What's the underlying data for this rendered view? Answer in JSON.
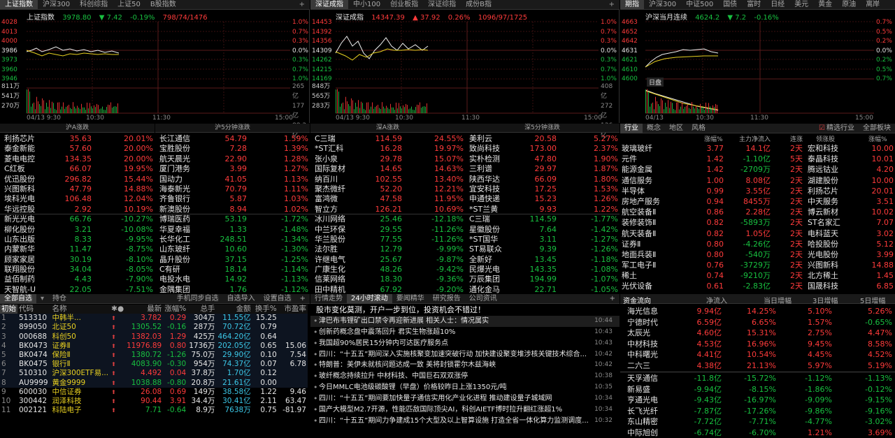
{
  "p1": {
    "tabs": [
      "上证指数",
      "沪深300",
      "科创综指",
      "上证50",
      "B股指数"
    ],
    "name": "上证指数",
    "price": "3978.80",
    "chg": "▼ 7.42",
    "pct": "-0.19%",
    "stat": "798/74/1476",
    "yl": [
      "4028",
      "4013",
      "4000",
      "3986",
      "3973",
      "3960",
      "3946"
    ],
    "yr": [
      "1.0%",
      "0.7%",
      "0.3%",
      "0.0%",
      "0.3%",
      "0.7%",
      "1.0%"
    ],
    "vl": [
      "811万",
      "541万",
      "270万"
    ],
    "vr": [
      "265亿",
      "177亿",
      "88.3亿"
    ],
    "t": [
      "04/13 9:30",
      "10:30",
      "11:30",
      "15:00"
    ]
  },
  "p2": {
    "tabs": [
      "深证成指",
      "中小100",
      "创业板指",
      "深证综指",
      "成份B指"
    ],
    "name": "深证成指",
    "price": "14347.39",
    "chg": "▲ 37.92",
    "pct": "0.26%",
    "stat": "1096/97/1725",
    "yl": [
      "14453",
      "14392",
      "14356",
      "14309",
      "14262",
      "14215",
      "14169"
    ],
    "yr": [
      "1.0%",
      "0.7%",
      "0.3%",
      "0.0%",
      "0.3%",
      "0.7%",
      "1.0%"
    ],
    "vl": [
      "848万",
      "565万",
      "283万"
    ],
    "vr": [
      "408亿",
      "272亿",
      "136亿"
    ],
    "t": [
      "04/13 9:30",
      "10:30",
      "11:30",
      "15:00"
    ]
  },
  "p3": {
    "tabs": [
      "期指",
      "沪深300",
      "中证500",
      "国债",
      "富时",
      "日经",
      "美元",
      "黄金",
      "原油",
      "离岸"
    ],
    "name": "沪深当月连续",
    "price": "4624.2",
    "chg": "▼ 7.2",
    "pct": "-0.16%",
    "yl": [
      "4663",
      "4652",
      "4642",
      "4631",
      "4621",
      "4610",
      "4600"
    ],
    "yr": [
      "0.7%",
      "0.5%",
      "0.2%",
      "0.0%",
      "0.2%",
      "0.5%",
      "0.7%"
    ],
    "t": [
      "04/13",
      "10:30",
      "11:30",
      "15:00"
    ],
    "daily": "日盘"
  },
  "ranks": {
    "h1": "沪A涨跌",
    "h2": "沪5分钟涨跌",
    "h3": "深A涨跌",
    "h4": "深5分钟涨跌",
    "c1": [
      [
        "利扬芯片",
        "35.63",
        "20.01%",
        "r"
      ],
      [
        "泰金新能",
        "57.60",
        "20.00%",
        "r"
      ],
      [
        "菱电电控",
        "134.35",
        "20.00%",
        "r"
      ],
      [
        "C红板",
        "66.07",
        "19.95%",
        "r"
      ],
      [
        "优迅股份",
        "296.82",
        "15.44%",
        "r"
      ],
      [
        "兴图新科",
        "47.79",
        "14.88%",
        "r"
      ],
      [
        "埃科光电",
        "106.48",
        "12.04%",
        "r"
      ],
      [
        "华远控股",
        "2.92",
        "10.19%",
        "r"
      ],
      [
        "新光光电",
        "66.76",
        "-10.27%",
        "g"
      ],
      [
        "柳化股份",
        "3.21",
        "-10.08%",
        "g"
      ],
      [
        "山东出版",
        "8.33",
        "-9.95%",
        "g"
      ],
      [
        "内蒙新华",
        "11.47",
        "-8.75%",
        "g"
      ],
      [
        "顾家家居",
        "30.19",
        "-8.10%",
        "g"
      ],
      [
        "联翔股份",
        "34.04",
        "-8.05%",
        "g"
      ],
      [
        "益佰制药",
        "4.43",
        "-7.90%",
        "g"
      ],
      [
        "天智航-U",
        "22.05",
        "-7.51%",
        "g"
      ]
    ],
    "c2": [
      [
        "长江通信",
        "54.79",
        "1.59%",
        "r"
      ],
      [
        "宝胜股份",
        "7.28",
        "1.39%",
        "r"
      ],
      [
        "航天晨光",
        "22.90",
        "1.28%",
        "r"
      ],
      [
        "厦门港务",
        "3.99",
        "1.27%",
        "r"
      ],
      [
        "国动力",
        "41.05",
        "1.13%",
        "r"
      ],
      [
        "海泰新光",
        "70.79",
        "1.11%",
        "r"
      ],
      [
        "齐鲁银行",
        "5.87",
        "1.03%",
        "r"
      ],
      [
        "新澳股份",
        "8.94",
        "1.02%",
        "r"
      ],
      [
        "博瑞医药",
        "53.19",
        "-1.72%",
        "g"
      ],
      [
        "华夏幸福",
        "1.33",
        "-1.48%",
        "g"
      ],
      [
        "长华化工",
        "248.51",
        "-1.34%",
        "g"
      ],
      [
        "山东玻纤",
        "10.60",
        "-1.30%",
        "g"
      ],
      [
        "晶升股份",
        "37.15",
        "-1.25%",
        "g"
      ],
      [
        "C有研",
        "18.14",
        "-1.14%",
        "g"
      ],
      [
        "电投水电",
        "14.92",
        "-1.13%",
        "g"
      ],
      [
        "金隅集团",
        "1.76",
        "-1.12%",
        "g"
      ]
    ],
    "c3": [
      [
        "C三瑞",
        "114.59",
        "24.55%",
        "r"
      ],
      [
        "*ST汇科",
        "16.28",
        "19.97%",
        "r"
      ],
      [
        "张小泉",
        "29.78",
        "15.07%",
        "r"
      ],
      [
        "国际复材",
        "14.65",
        "14.63%",
        "r"
      ],
      [
        "纳百川",
        "102.55",
        "13.40%",
        "r"
      ],
      [
        "聚杰微纤",
        "52.20",
        "12.21%",
        "r"
      ],
      [
        "富鸿微",
        "47.58",
        "11.95%",
        "r"
      ],
      [
        "智立方",
        "126.21",
        "10.69%",
        "r"
      ],
      [
        "冰川网络",
        "25.46",
        "-12.18%",
        "g"
      ],
      [
        "中兰环保",
        "29.55",
        "-11.26%",
        "g"
      ],
      [
        "华兰股份",
        "77.55",
        "-11.26%",
        "g"
      ],
      [
        "法尔胜",
        "12.79",
        "-9.99%",
        "g"
      ],
      [
        "许继电气",
        "25.67",
        "-9.87%",
        "g"
      ],
      [
        "广康生化",
        "48.26",
        "-9.42%",
        "g"
      ],
      [
        "信莱网络",
        "18.30",
        "-9.36%",
        "g"
      ],
      [
        "田中精机",
        "67.92",
        "-9.20%",
        "g"
      ]
    ],
    "c4": [
      [
        "美利云",
        "20.58",
        "5.27%",
        "r"
      ],
      [
        "致尚科技",
        "173.00",
        "2.37%",
        "r"
      ],
      [
        "实朴检测",
        "47.80",
        "1.90%",
        "r"
      ],
      [
        "三利谱",
        "29.97",
        "1.87%",
        "r"
      ],
      [
        "陕西华达",
        "66.09",
        "1.80%",
        "r"
      ],
      [
        "宜安科技",
        "17.25",
        "1.53%",
        "r"
      ],
      [
        "申通快递",
        "15.23",
        "1.26%",
        "r"
      ],
      [
        "*ST兰黄",
        "9.93",
        "1.22%",
        "r"
      ],
      [
        "C三瑞",
        "114.59",
        "-1.77%",
        "g"
      ],
      [
        "星徽股份",
        "7.64",
        "-1.42%",
        "g"
      ],
      [
        "*ST国华",
        "3.11",
        "-1.27%",
        "g"
      ],
      [
        "ST易联众",
        "9.39",
        "-1.26%",
        "g"
      ],
      [
        "全新好",
        "13.45",
        "-1.18%",
        "g"
      ],
      [
        "民爆光电",
        "143.35",
        "-1.08%",
        "g"
      ],
      [
        "万辰集团",
        "194.99",
        "-1.07%",
        "g"
      ],
      [
        "通化金马",
        "22.71",
        "-1.05%",
        "g"
      ]
    ]
  },
  "sectors": {
    "tabs": [
      "行业",
      "概念",
      "地区",
      "风格"
    ],
    "chk": "精选行业",
    "all": "全部板块",
    "h": [
      "涨幅%",
      "主力净流入",
      "连涨",
      "领涨股",
      "涨幅%"
    ],
    "rows": [
      [
        "玻璃玻纤",
        "3.77",
        "14.1亿",
        "2天",
        "宏和科技",
        "10.00"
      ],
      [
        "元件",
        "1.42",
        "-1.10亿",
        "5天",
        "泰晶科技",
        "10.01"
      ],
      [
        "能源金属",
        "1.42",
        "-2709万",
        "2天",
        "腾远钴业",
        "4.20"
      ],
      [
        "通信服务",
        "1.00",
        "8.08亿",
        "2天",
        "湖建股份",
        "10.00"
      ],
      [
        "半导体",
        "0.99",
        "3.55亿",
        "2天",
        "利扬芯片",
        "20.01"
      ],
      [
        "房地产服务",
        "0.94",
        "8455万",
        "2天",
        "中天服务",
        "3.51"
      ],
      [
        "航空装备Ⅱ",
        "0.86",
        "2.28亿",
        "2天",
        "博云新材",
        "10.02"
      ],
      [
        "装修装饰Ⅱ",
        "0.82",
        "-5893万",
        "2天",
        "ST名家汇",
        "7.07"
      ],
      [
        "航天装备Ⅱ",
        "0.82",
        "1.05亿",
        "2天",
        "电科蓝天",
        "3.02"
      ],
      [
        "证券Ⅱ",
        "0.80",
        "-4.26亿",
        "2天",
        "哈投股份",
        "5.12"
      ],
      [
        "地面兵装Ⅱ",
        "0.80",
        "-540万",
        "2天",
        "光电股份",
        "3.99"
      ],
      [
        "军工电子Ⅱ",
        "0.76",
        "-3729万",
        "2天",
        "兴图新科",
        "14.88"
      ],
      [
        "稀土",
        "0.74",
        "-9210万",
        "2天",
        "北方稀土",
        "1.45"
      ],
      [
        "光伏设备",
        "0.61",
        "-2.83亿",
        "2天",
        "国晟科技",
        "6.85"
      ]
    ]
  },
  "quotes": {
    "tabs": [
      "全部自选",
      "持仓"
    ],
    "links": [
      "手机同步自选",
      "自选导入",
      "设置自选"
    ],
    "h": [
      "初始",
      "代码",
      "名称",
      "",
      "最新",
      "涨幅%",
      "总手",
      "金额",
      "换手%",
      "市盈率"
    ],
    "rows": [
      [
        "1",
        "513310",
        "中韩半...",
        "3.782",
        "0.29",
        "304万",
        "11.55亿",
        "15.25",
        ""
      ],
      [
        "2",
        "899050",
        "北证50",
        "1305.52",
        "-0.16",
        "287万",
        "70.72亿",
        "0.79",
        ""
      ],
      [
        "3",
        "000688",
        "科创50",
        "1382.03",
        "1.29",
        "425万",
        "464.20亿",
        "0.64",
        ""
      ],
      [
        "4",
        "BK0473",
        "证券Ⅱ",
        "11976.89",
        "0.80",
        "1736万",
        "202.05亿",
        "0.65",
        "15.06"
      ],
      [
        "5",
        "BK0474",
        "保险Ⅱ",
        "1380.72",
        "-1.26",
        "75.0万",
        "29.90亿",
        "0.10",
        "7.54"
      ],
      [
        "6",
        "BK0475",
        "银行Ⅱ",
        "4083.90",
        "-0.30",
        "954万",
        "74.37亿",
        "0.07",
        "6.78"
      ],
      [
        "7",
        "510310",
        "沪深300ETF易...",
        "4.492",
        "0.04",
        "37.8万",
        "1.70亿",
        "0.12",
        ""
      ],
      [
        "8",
        "AU9999",
        "黄金9999",
        "1038.88",
        "-0.80",
        "20.8万",
        "21.61亿",
        "0.00",
        ""
      ],
      [
        "9",
        "600030",
        "中信证券",
        "26.08",
        "0.69",
        "149万",
        "38.58亿",
        "1.22",
        "9.46"
      ],
      [
        "10",
        "300442",
        "润泽科技",
        "90.44",
        "3.91",
        "34.4万",
        "30.41亿",
        "2.11",
        "63.47"
      ],
      [
        "11",
        "002121",
        "科陆电子",
        "7.71",
        "-0.64",
        "8.9万",
        "7638万",
        "0.75",
        "-81.97"
      ]
    ]
  },
  "news": {
    "tabs": [
      "行情走势",
      "24小时滚动",
      "要闻精华",
      "研究报告",
      "公司资讯"
    ],
    "items": [
      [
        "股市变化莫测，开户一步到位，投资机会不错过！",
        ""
      ],
      [
        "津巴布韦锂矿出口禁令再迎新进展 相关人士：情况属实",
        "10:44"
      ],
      [
        "创新药概念盘中震荡回升 君实生物涨超10%",
        "10:43"
      ],
      [
        "我国超90%居民15分钟内可达医疗服务点",
        "10:43"
      ],
      [
        "四川：“十五五”期间深入实施核聚变加速突破行动 加快建设聚变堆涉核关键技术综合...",
        "10:42"
      ],
      [
        "特朗普：美伊未就核问题达成一致 美将封锁霍尔木兹海峡",
        "10:42"
      ],
      [
        "玻纤概念持续拉升 中材科技、中国巨石双双涨停",
        "10:38"
      ],
      [
        "今日MMLC电池级碳酸锂（早盘）价格较昨日上涨1350元/吨",
        "10:35"
      ],
      [
        "四川：“十五五”期间要加快量子通信实用化产业化进程 推动建设量子城域网",
        "10:34"
      ],
      [
        "国产大模型M2.7开源，性能匹敌国际顶尖AI，科创AIETF博时拉升翻红涨超1%",
        "10:34"
      ],
      [
        "四川：“十五五”期间力争建成15个大型及以上智算设施 打造全省一体化算力监测调度...",
        "10:32"
      ]
    ]
  },
  "flow": {
    "tabs": [
      "资金流向",
      "净流入",
      "当日增幅",
      "3日增幅",
      "5日增幅"
    ],
    "top": [
      [
        "海光信息",
        "9.94亿",
        "14.25%",
        "5.10%",
        "5.26%"
      ],
      [
        "宁德时代",
        "6.59亿",
        "6.65%",
        "1.57%",
        "-0.65%"
      ],
      [
        "太辰光",
        "4.60亿",
        "15.31%",
        "2.75%",
        "4.47%"
      ],
      [
        "中材科技",
        "4.53亿",
        "16.96%",
        "9.45%",
        "8.58%"
      ],
      [
        "中科曙光",
        "4.41亿",
        "10.54%",
        "4.45%",
        "4.52%"
      ],
      [
        "二六三",
        "4.38亿",
        "21.13%",
        "5.97%",
        "5.19%"
      ]
    ],
    "bot": [
      [
        "天孚通信",
        "-11.8亿",
        "-15.72%",
        "-1.12%",
        "-1.13%"
      ],
      [
        "新易盛",
        "-9.94亿",
        "-8.15%",
        "-1.86%",
        "-0.12%"
      ],
      [
        "亨通光电",
        "-9.43亿",
        "-16.97%",
        "-9.09%",
        "-9.15%"
      ],
      [
        "长飞光纤",
        "-7.87亿",
        "-17.26%",
        "-9.86%",
        "-9.16%"
      ],
      [
        "东山精密",
        "-7.72亿",
        "-7.71%",
        "-4.77%",
        "-3.02%"
      ],
      [
        "中际旭创",
        "-6.74亿",
        "-6.70%",
        "1.21%",
        "3.69%"
      ]
    ]
  }
}
